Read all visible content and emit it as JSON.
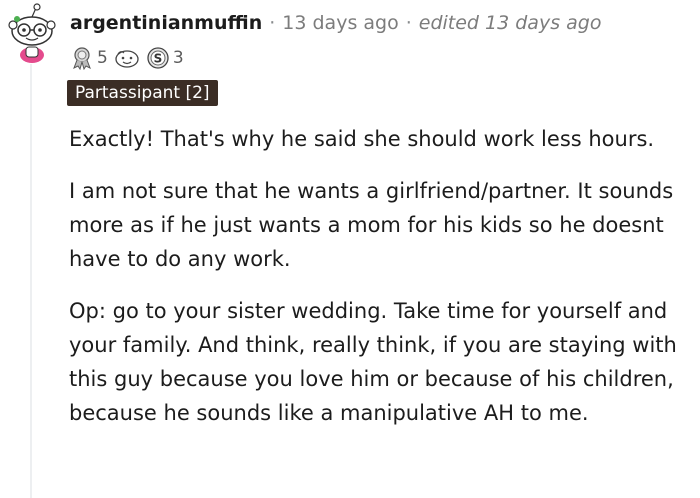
{
  "comment": {
    "author": "argentinianmuffin",
    "separator": "·",
    "time": "13 days ago",
    "edited": "edited 13 days ago",
    "awards": [
      {
        "icon": "silver-award-icon",
        "count": "5"
      },
      {
        "icon": "wholesome-award-icon",
        "count": ""
      },
      {
        "icon": "s-coin-award-icon",
        "count": "3"
      }
    ],
    "flair": "Partassipant [2]",
    "paragraphs": [
      "Exactly! That's why he said she should work less hours.",
      "I am not sure that he wants a girlfriend/partner. It sounds more as if he just wants a mom for his kids so he doesnt have to do any work.",
      "Op: go to your sister wedding. Take time for yourself and your family. And think, really think, if you are staying with this guy because you love him or because of his children, because he sounds like a manipulative AH to me."
    ]
  },
  "colors": {
    "flair_bg": "#3b2d25",
    "username": "#1c1c1c",
    "meta": "#7c7c7c",
    "thread_line": "#edeff1"
  }
}
